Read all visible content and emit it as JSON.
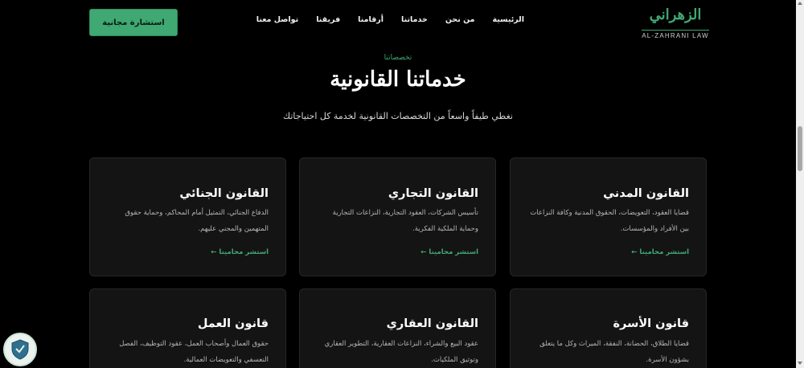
{
  "header": {
    "logo_ar": "الزهراني",
    "logo_en": "AL-ZAHRANI LAW",
    "nav": [
      "الرئيسية",
      "من نحن",
      "خدماتنا",
      "أرقامنا",
      "فريقنا",
      "تواصل معنا"
    ],
    "cta_label": "استشارة مجانية"
  },
  "section": {
    "eyebrow": "تخصصاتنا",
    "title": "خدماتنا القانونية",
    "subtitle": "نغطي طيفاً واسعاً من التخصصات القانونية لخدمة كل احتياجاتك"
  },
  "cards": [
    {
      "title": "القانون المدني",
      "desc": "قضايا العقود، التعويضات، الحقوق المدنية وكافة النزاعات بين الأفراد والمؤسسات.",
      "link": "استشر محامينا ←"
    },
    {
      "title": "القانون التجاري",
      "desc": "تأسيس الشركات، العقود التجارية، النزاعات التجارية وحماية الملكية الفكرية.",
      "link": "استشر محامينا ←"
    },
    {
      "title": "القانون الجنائي",
      "desc": "الدفاع الجنائي، التمثيل أمام المحاكم، وحماية حقوق المتهمين والمجني عليهم.",
      "link": "استشر محامينا ←"
    },
    {
      "title": "قانون الأسرة",
      "desc": "قضايا الطلاق، الحضانة، النفقة، الميراث وكل ما يتعلق بشؤون الأسرة.",
      "link": ""
    },
    {
      "title": "القانون العقاري",
      "desc": "عقود البيع والشراء، النزاعات العقارية، التطوير العقاري وتوثيق الملكيات.",
      "link": ""
    },
    {
      "title": "قانون العمل",
      "desc": "حقوق العمال وأصحاب العمل، عقود التوظيف، الفصل التعسفي والتعويضات العمالية.",
      "link": ""
    }
  ],
  "colors": {
    "accent": "#3fa873",
    "background": "#000000",
    "card": "#141414"
  },
  "icons": {
    "badge": "shield-badge-icon"
  }
}
